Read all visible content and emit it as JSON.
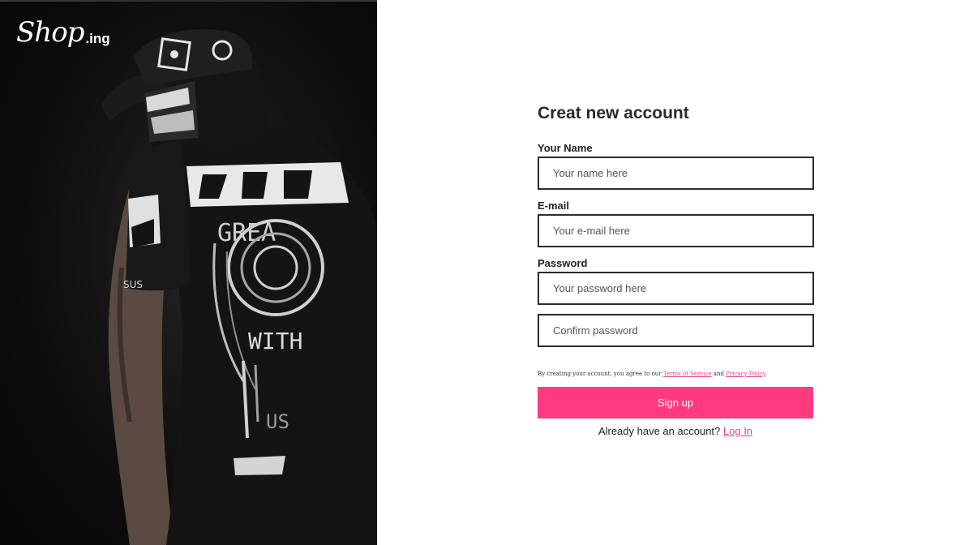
{
  "brand": {
    "logo_script": "Shop",
    "logo_suffix": ".ing"
  },
  "form": {
    "title": "Creat new account",
    "name_label": "Your Name",
    "name_placeholder": "Your name here",
    "email_label": "E-mail",
    "email_placeholder": "Your e-mail here",
    "password_label": "Password",
    "password_placeholder": "Your password here",
    "confirm_placeholder": "Confirm password",
    "terms_prefix": "By creating your account, you agree to our",
    "terms_link": "Terms of Service",
    "terms_and": "and",
    "privacy_link": "Privacy Policy",
    "terms_suffix": ".",
    "signup_label": "Sign up",
    "login_prompt": "Already have an account?",
    "login_link": "Log In"
  },
  "colors": {
    "accent": "#ff3a80",
    "link": "#e8427d",
    "panel_bg": "#0b0b0b"
  }
}
